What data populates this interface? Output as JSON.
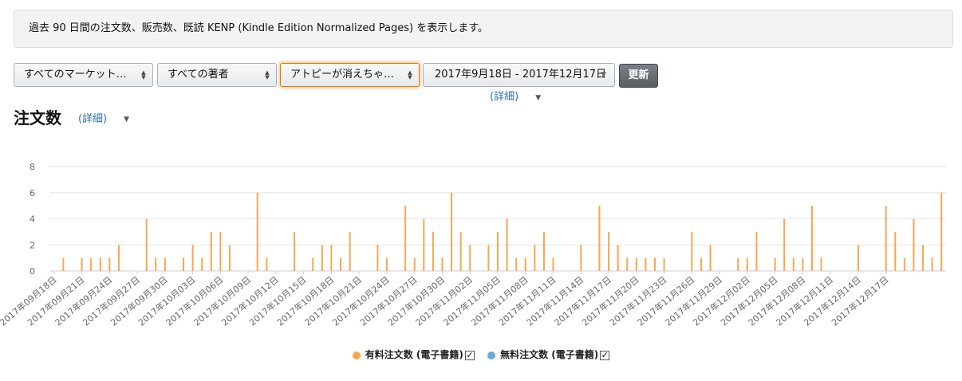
{
  "notice": {
    "text": "過去 90 日間の注文数、販売数、既読 KENP (Kindle Edition Normalized Pages) を表示します。"
  },
  "filters": {
    "marketplace": "すべてのマーケット…",
    "author": "すべての著者",
    "title": "アトピーが消えちゃ…",
    "date_range": "2017年9月18日 - 2017年12月17日",
    "date_detail_link": "(詳細)",
    "update_label": "更新"
  },
  "section": {
    "title": "注文数",
    "detail_link": "(詳細)"
  },
  "legend": {
    "paid": "有料注文数 (電子書籍)",
    "free": "無料注文数 (電子書籍)"
  },
  "colors": {
    "paid": "#f9a650",
    "free": "#6aa8e2",
    "grid": "#e6e6e6",
    "axis_label": "#666666"
  },
  "chart_data": {
    "type": "bar",
    "ylim": [
      0,
      8
    ],
    "yticks": [
      "0",
      "2",
      "4",
      "6",
      "8"
    ],
    "start_date": "2017-09-18",
    "tick_labels": [
      "2017年09月18日",
      "2017年09月21日",
      "2017年09月24日",
      "2017年09月27日",
      "2017年09月30日",
      "2017年10月03日",
      "2017年10月06日",
      "2017年10月09日",
      "2017年10月12日",
      "2017年10月15日",
      "2017年10月18日",
      "2017年10月21日",
      "2017年10月24日",
      "2017年10月27日",
      "2017年10月30日",
      "2017年11月02日",
      "2017年11月05日",
      "2017年11月08日",
      "2017年11月11日",
      "2017年11月14日",
      "2017年11月17日",
      "2017年11月20日",
      "2017年11月23日",
      "2017年11月26日",
      "2017年11月29日",
      "2017年12月02日",
      "2017年12月05日",
      "2017年12月08日",
      "2017年12月11日",
      "2017年12月14日",
      "2017年12月17日"
    ],
    "series": [
      {
        "name": "有料注文数 (電子書籍)",
        "values": [
          0,
          1,
          0,
          1,
          1,
          1,
          1,
          2,
          0,
          0,
          4,
          1,
          1,
          0,
          1,
          2,
          1,
          3,
          3,
          2,
          0,
          0,
          6,
          1,
          0,
          0,
          3,
          0,
          1,
          2,
          2,
          1,
          3,
          0,
          0,
          2,
          1,
          0,
          5,
          1,
          4,
          3,
          1,
          6,
          3,
          2,
          0,
          2,
          3,
          4,
          1,
          1,
          2,
          3,
          1,
          0,
          0,
          2,
          0,
          5,
          3,
          2,
          1,
          1,
          1,
          1,
          1,
          0,
          0,
          3,
          1,
          2,
          0,
          0,
          1,
          1,
          3,
          0,
          1,
          4,
          1,
          1,
          5,
          1,
          0,
          0,
          0,
          2,
          0,
          0,
          5,
          3,
          1,
          4,
          2,
          1,
          6
        ]
      },
      {
        "name": "無料注文数 (電子書籍)",
        "values": [
          0,
          0,
          0,
          0,
          0,
          0,
          0,
          0,
          0,
          0,
          0,
          0,
          0,
          0,
          0,
          0,
          0,
          0,
          0,
          0,
          0,
          0,
          0,
          0,
          0,
          0,
          0,
          0,
          0,
          0,
          0,
          0,
          0,
          0,
          0,
          0,
          0,
          0,
          0,
          0,
          0,
          0,
          0,
          0,
          0,
          0,
          0,
          0,
          0,
          0,
          0,
          0,
          0,
          0,
          0,
          0,
          0,
          0,
          0,
          0,
          0,
          0,
          0,
          0,
          0,
          0,
          0,
          0,
          0,
          0,
          0,
          0,
          0,
          0,
          0,
          0,
          0,
          0,
          0,
          0,
          0,
          0,
          0,
          0,
          0,
          0,
          0,
          0,
          0,
          0,
          0,
          0
        ]
      }
    ]
  }
}
